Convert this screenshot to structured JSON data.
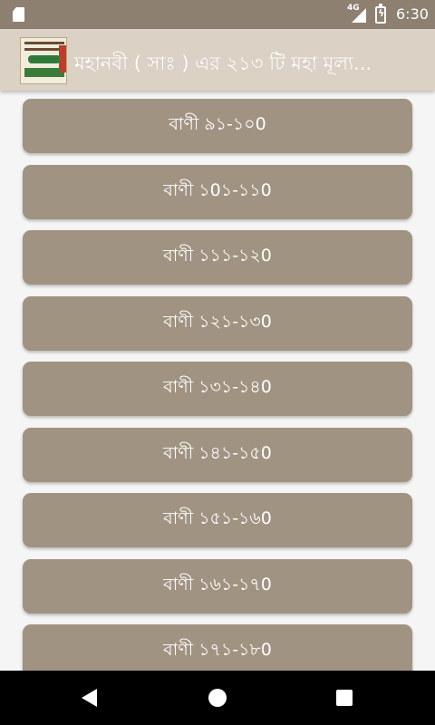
{
  "status_bar": {
    "network": "4G",
    "time": "6:30",
    "icons": [
      "sd-card-icon",
      "signal-icon",
      "battery-charging-icon"
    ]
  },
  "app_bar": {
    "title": "মহানবী ( সাঃ ) এর ২১৩ টি মহা মূল্য...",
    "logo": "app-logo-icon"
  },
  "colors": {
    "status_bar": "#8e8071",
    "app_bar": "#dcd1c5",
    "button": "#a19382",
    "background": "#f5f5f5",
    "nav_bar": "#000000"
  },
  "items": [
    {
      "label": "বাণী ৯১-১০0"
    },
    {
      "label": "বাণী ১0১-১১0"
    },
    {
      "label": "বাণী ১১১-১২0"
    },
    {
      "label": "বাণী ১২১-১৩0"
    },
    {
      "label": "বাণী ১৩১-১৪0"
    },
    {
      "label": "বাণী ১৪১-১৫0"
    },
    {
      "label": "বাণী ১৫১-১৬0"
    },
    {
      "label": "বাণী ১৬১-১৭0"
    },
    {
      "label": "বাণী ১৭১-১৮0"
    }
  ],
  "nav": {
    "icons": [
      "back-icon",
      "home-icon",
      "recents-icon"
    ]
  }
}
